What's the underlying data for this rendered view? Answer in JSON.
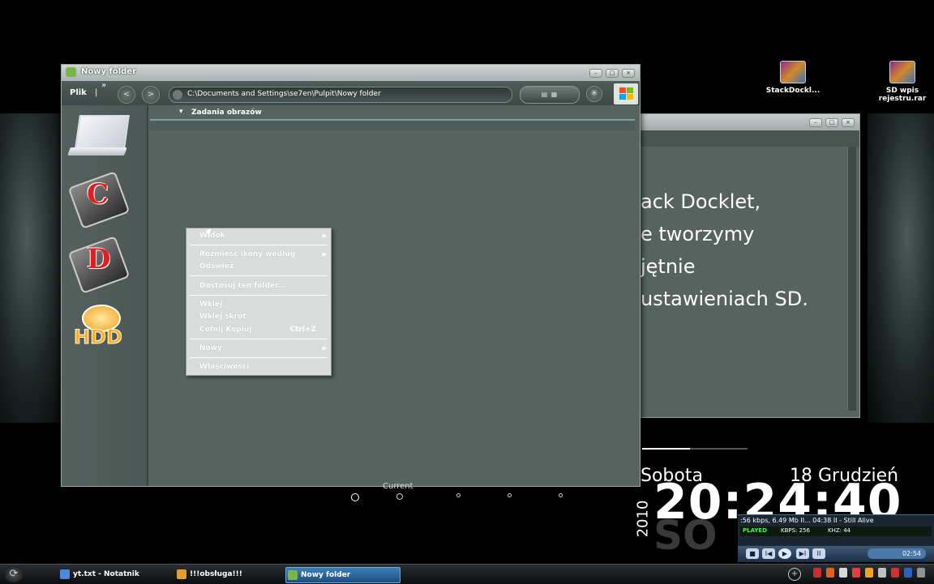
{
  "desktop": {
    "icons": [
      {
        "label": "StackDockl..."
      },
      {
        "label_line1": "SD wpis",
        "label_line2": "rejestru.rar"
      }
    ]
  },
  "explorer": {
    "title": "Nowy folder",
    "menu": {
      "file": "Plik",
      "separator": "|",
      "more": "»"
    },
    "address": "C:\\Documents and Settings\\se7en\\Pulpit\\Nowy folder",
    "tasks_header": "Zadania obrazów",
    "sidebar_drives": [
      {
        "icon": "laptop-icon"
      },
      {
        "letter": "C"
      },
      {
        "letter": "D"
      },
      {
        "text": "HDD"
      }
    ]
  },
  "context_menu": {
    "items": [
      {
        "label": "Widok",
        "arrow": true
      },
      {
        "label": "Rozmieść ikony według",
        "arrow": true
      },
      {
        "label": "Odśwież"
      },
      {
        "label": "Dostosuj ten folder..."
      },
      {
        "label": "Wklej"
      },
      {
        "label": "Wklej skrót"
      },
      {
        "label": "Cofnij Kopiuj",
        "shortcut": "Ctrl+Z"
      },
      {
        "label": "Nowy",
        "arrow": true
      },
      {
        "label": "Właściwości"
      }
    ]
  },
  "notepad": {
    "lines": [
      "ack Docklet,",
      "e tworzymy",
      "jętnie",
      "ustawieniach SD."
    ]
  },
  "clock": {
    "day": "Sobota",
    "date": "18  Grudzień",
    "year": "2010",
    "time": "20:24:40",
    "time_secondary": "SO",
    "progress": 0.45
  },
  "loader": {
    "label": "Current"
  },
  "media_player": {
    "info": ":56 kbps, 6.49 Mb II... 04:38 II - Still Alive",
    "played": "PLAYED",
    "kbps": "KBPS: 256",
    "khz": "KHZ: 44",
    "time": "02:54",
    "buttons": [
      "■",
      "I◀",
      "▶",
      "▶I",
      "II"
    ]
  },
  "taskbar": {
    "start_icon": "start-orb-icon",
    "items": [
      {
        "label": "yt.txt - Notatnik",
        "color": "#4a8ad8"
      },
      {
        "label": "!!!obsługa!!!",
        "color": "#e0a030"
      },
      {
        "label": "Nowy folder",
        "color": "#7ab648",
        "active": true
      }
    ]
  },
  "colors": {
    "window_bg": "#56635f",
    "menu_bg": "#d8dcdb",
    "taskbar_active": "#3b7fb8"
  }
}
